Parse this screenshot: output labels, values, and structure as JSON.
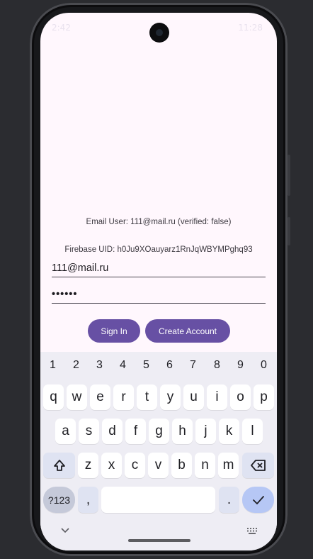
{
  "status_bar": {
    "time": "2:42",
    "right": "11:28"
  },
  "auth": {
    "email_user": "Email User: 111@mail.ru (verified: false)",
    "firebase_uid": "Firebase UID: h0Ju9XOauyarz1RnJqWBYMPghq93",
    "email_value": "111@mail.ru",
    "password_value": "••••••",
    "sign_in_label": "Sign In",
    "create_account_label": "Create Account"
  },
  "keyboard": {
    "numbers": [
      "1",
      "2",
      "3",
      "4",
      "5",
      "6",
      "7",
      "8",
      "9",
      "0"
    ],
    "row1": [
      "q",
      "w",
      "e",
      "r",
      "t",
      "y",
      "u",
      "i",
      "o",
      "p"
    ],
    "row2": [
      "a",
      "s",
      "d",
      "f",
      "g",
      "h",
      "j",
      "k",
      "l"
    ],
    "row3": [
      "z",
      "x",
      "c",
      "v",
      "b",
      "n",
      "m"
    ],
    "mode_label": "?123",
    "comma_label": ",",
    "period_label": ".",
    "shift_icon": "shift-icon",
    "backspace_icon": "backspace-icon",
    "enter_icon": "checkmark-icon",
    "hide_icon": "chevron-down-icon",
    "grid_icon": "keyboard-grid-icon"
  },
  "colors": {
    "accent": "#6750a4",
    "background": "#fff7fd",
    "keyboard_bg": "#eeedf4"
  }
}
